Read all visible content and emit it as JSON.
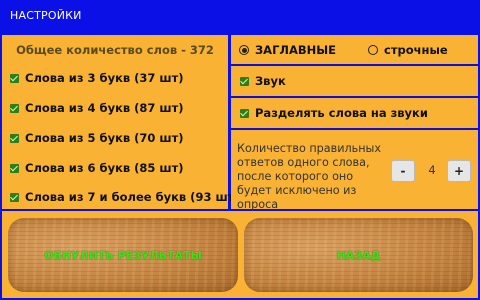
{
  "header": {
    "title": "НАСТРОЙКИ"
  },
  "words": {
    "total_label": "Общее количество слов - 372",
    "groups": [
      {
        "label": "Слова из 3 букв (37 шт)",
        "checked": true
      },
      {
        "label": "Слова из 4 букв (87 шт)",
        "checked": true
      },
      {
        "label": "Слова из 5 букв (70 шт)",
        "checked": true
      },
      {
        "label": "Слова из 6 букв (85 шт)",
        "checked": true
      },
      {
        "label": "Слова из 7 и более букв (93 шт)",
        "checked": true
      }
    ]
  },
  "case": {
    "upper_label": "ЗАГЛАВНЫЕ",
    "lower_label": "строчные",
    "selected": "upper"
  },
  "options": {
    "sound_label": "Звук",
    "sound_checked": true,
    "split_label": "Разделять слова на звуки",
    "split_checked": true
  },
  "threshold": {
    "description": "Количество правильных ответов одного слова, после которого оно будет исключено из опроса",
    "minus_label": "-",
    "plus_label": "+",
    "value": "4"
  },
  "buttons": {
    "reset_label": "ОБНУЛИТЬ РЕЗУЛЬТАТЫ",
    "back_label": "НАЗАД"
  },
  "colors": {
    "background": "#0b10e6",
    "panel": "#f9b233",
    "check": "#2e7d1e",
    "button_text": "#3de01b"
  }
}
